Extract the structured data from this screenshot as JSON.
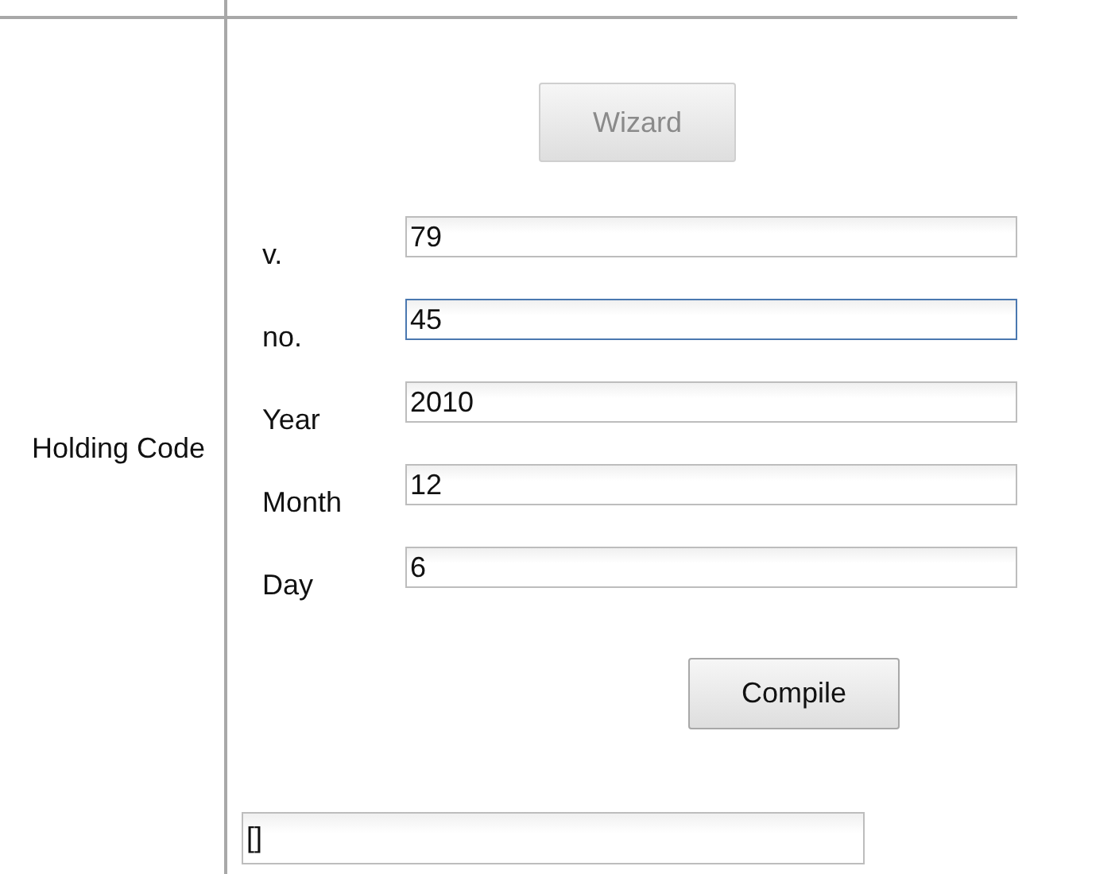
{
  "label": "Holding Code",
  "wizard_button": {
    "label": "Wizard",
    "disabled": true
  },
  "fields": [
    {
      "label": "v.",
      "value": "79",
      "focused": false
    },
    {
      "label": "no.",
      "value": "45",
      "focused": true
    },
    {
      "label": "Year",
      "value": "2010",
      "focused": false
    },
    {
      "label": "Month",
      "value": "12",
      "focused": false
    },
    {
      "label": "Day",
      "value": "6",
      "focused": false
    }
  ],
  "compile_button": {
    "label": "Compile",
    "disabled": false
  },
  "result": {
    "value": "[]"
  }
}
